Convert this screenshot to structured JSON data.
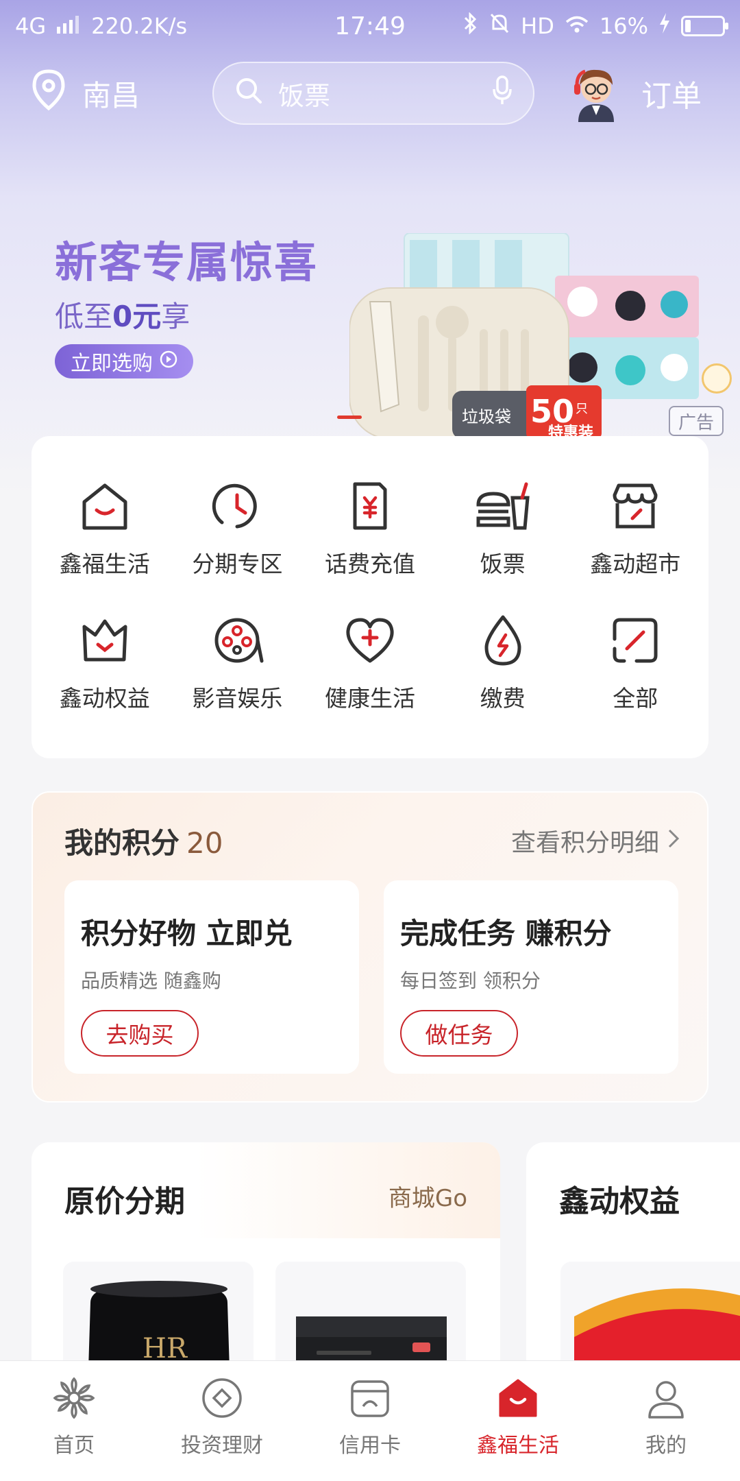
{
  "status": {
    "network": "4G",
    "speed": "220.2K/s",
    "time": "17:49",
    "hd": "HD",
    "battery": "16%",
    "battery_level": 0.16
  },
  "header": {
    "city": "南昌",
    "search_placeholder": "饭票",
    "orders_label": "订单"
  },
  "banner": {
    "title": "新客专属惊喜",
    "subtitle_pre": "低至",
    "subtitle_bold": "0元",
    "subtitle_post": "享",
    "button": "立即选购",
    "ad_tag": "广告",
    "img_badge": "50",
    "img_badge_unit": "只",
    "img_sub": "特惠装",
    "img_bag_text": "垃圾袋"
  },
  "grid": [
    {
      "label": "鑫福生活",
      "icon": "house-smile-icon"
    },
    {
      "label": "分期专区",
      "icon": "clock-icon"
    },
    {
      "label": "话费充值",
      "icon": "phone-yen-icon"
    },
    {
      "label": "饭票",
      "icon": "burger-drink-icon"
    },
    {
      "label": "鑫动超市",
      "icon": "store-icon"
    },
    {
      "label": "鑫动权益",
      "icon": "crown-icon"
    },
    {
      "label": "影音娱乐",
      "icon": "film-reel-icon"
    },
    {
      "label": "健康生活",
      "icon": "heart-plus-icon"
    },
    {
      "label": "缴费",
      "icon": "water-drop-icon"
    },
    {
      "label": "全部",
      "icon": "all-apps-icon"
    }
  ],
  "points": {
    "title": "我的积分",
    "value": "20",
    "link": "查看积分明细",
    "cards": [
      {
        "title": "积分好物 立即兑",
        "desc": "品质精选 随鑫购",
        "button": "去购买"
      },
      {
        "title": "完成任务 赚积分",
        "desc": "每日签到 领积分",
        "button": "做任务"
      }
    ]
  },
  "product_section": {
    "title": "原价分期",
    "tag": "商城Go",
    "thumb1_text": "HR"
  },
  "rights_section": {
    "title": "鑫动权益"
  },
  "bottom_nav": [
    {
      "label": "首页",
      "icon": "flower-icon"
    },
    {
      "label": "投资理财",
      "icon": "diamond-circle-icon"
    },
    {
      "label": "信用卡",
      "icon": "credit-card-icon"
    },
    {
      "label": "鑫福生活",
      "icon": "house-smile-icon",
      "active": true
    },
    {
      "label": "我的",
      "icon": "person-icon"
    }
  ],
  "colors": {
    "accent": "#d8252b",
    "banner_purple": "#8a6fd9"
  }
}
